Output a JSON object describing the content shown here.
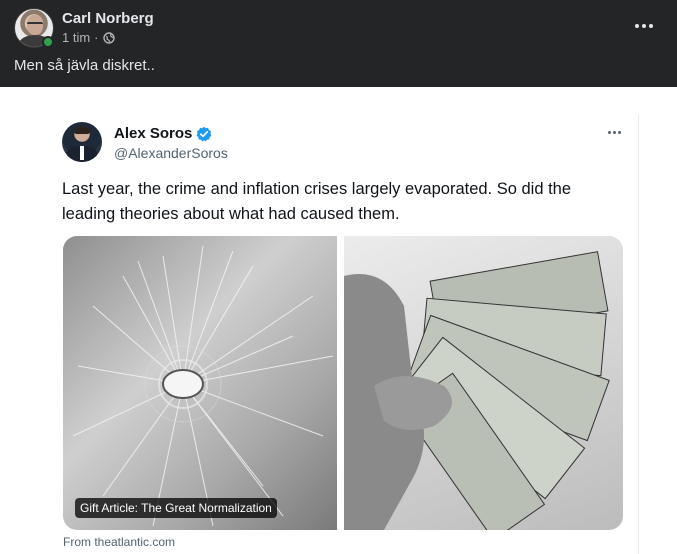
{
  "post": {
    "author": "Carl Norberg",
    "time": "1 tim",
    "separator": "·",
    "privacy_icon": "globe-icon",
    "text": "Men så jävla diskret.."
  },
  "tweet": {
    "name": "Alex Soros",
    "handle": "@AlexanderSoros",
    "verified_icon": "verified-badge-icon",
    "text": "Last year, the crime and inflation crises largely evaporated. So did the leading theories about what had caused them.",
    "image_caption": "Gift Article: The Great Normalization",
    "source": "From theatlantic.com"
  },
  "colors": {
    "background": "#242526",
    "text_primary": "#e4e6eb",
    "text_secondary": "#b0b3b8",
    "online": "#31a24c",
    "verified": "#1d9bf0"
  }
}
